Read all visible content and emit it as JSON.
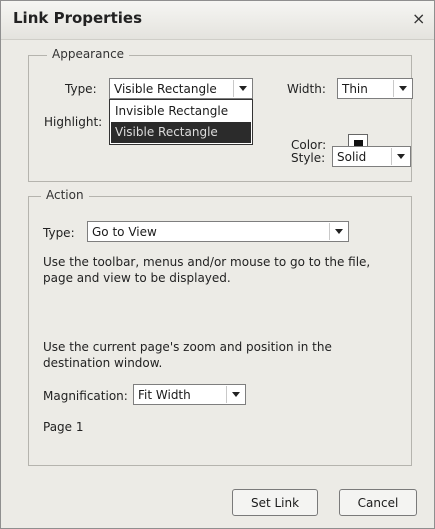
{
  "window": {
    "title": "Link Properties",
    "close_glyph": "×"
  },
  "appearance": {
    "legend": "Appearance",
    "type_label": "Type:",
    "type_value": "Visible Rectangle",
    "type_options": [
      "Invisible Rectangle",
      "Visible Rectangle"
    ],
    "highlight_label": "Highlight:",
    "width_label": "Width:",
    "width_value": "Thin",
    "color_label": "Color:",
    "color_value": "#111111",
    "style_label": "Style:",
    "style_value": "Solid"
  },
  "action": {
    "legend": "Action",
    "type_label": "Type:",
    "type_value": "Go to View",
    "instructions": "Use the toolbar, menus and/or mouse to go to the file, page and view to be displayed.",
    "zoom_note": "Use the current page's zoom and position in the destination window.",
    "magnification_label": "Magnification:",
    "magnification_value": "Fit Width",
    "page_info": "Page 1"
  },
  "buttons": {
    "set_link": "Set Link",
    "cancel": "Cancel"
  },
  "icons": {
    "dropdown_arrow": "chevron-down-icon",
    "close": "close-icon",
    "color": "color-swatch-icon"
  }
}
